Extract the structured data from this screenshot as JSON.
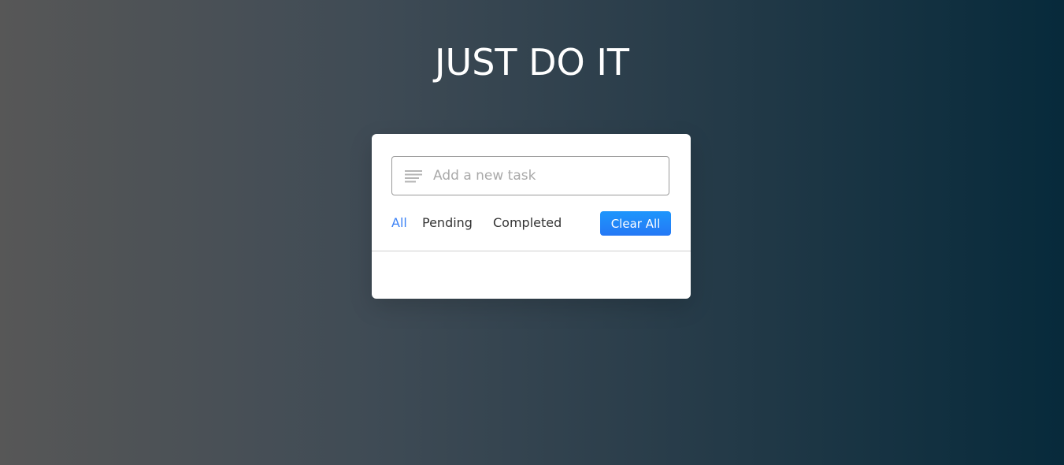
{
  "header": {
    "title": "JUST DO IT"
  },
  "task_input": {
    "placeholder": "Add a new task",
    "value": "",
    "icon": "lines-icon"
  },
  "filters": [
    {
      "label": "All",
      "active": true
    },
    {
      "label": "Pending",
      "active": false
    },
    {
      "label": "Completed",
      "active": false
    }
  ],
  "clear_button": {
    "label": "Clear All"
  },
  "tasks": [],
  "colors": {
    "accent": "#3b82f6",
    "button": "#1e88f9",
    "text": "#333333",
    "placeholder": "#a9a9a9"
  }
}
